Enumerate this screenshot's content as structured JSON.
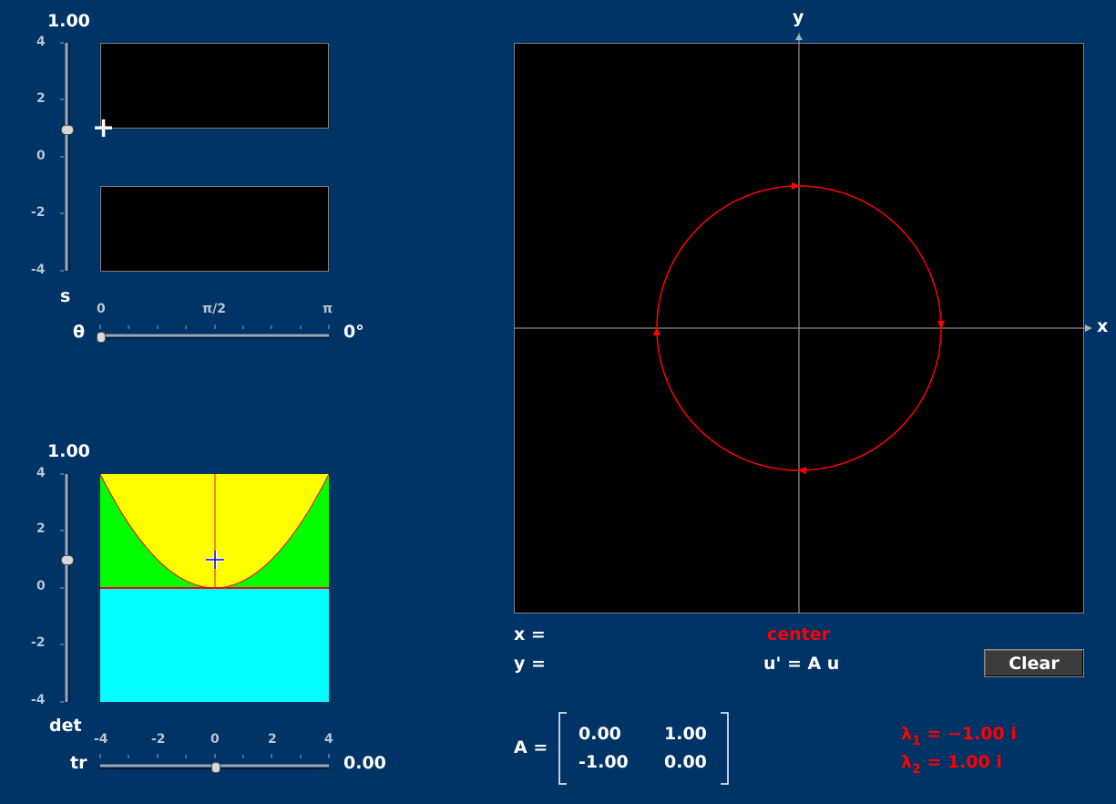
{
  "top_panel": {
    "value_label": "1.00",
    "y_ticks": [
      "4",
      "2",
      "0",
      "-2",
      "-4"
    ],
    "slider_label": "s",
    "theta_label": "θ",
    "theta_ticks": [
      "0",
      "π/2",
      "π"
    ],
    "theta_value": "0°",
    "theta_fraction": 0
  },
  "bottom_panel": {
    "value_label": "1.00",
    "y_ticks": [
      "4",
      "2",
      "0",
      "-2",
      "-4"
    ],
    "slider_label": "det",
    "x_ticks": [
      "-4",
      "-2",
      "0",
      "2",
      "4"
    ],
    "tr_label": "tr",
    "tr_value": "0.00",
    "colors": {
      "stable_region": "#ffff00",
      "spiral_region": "#00ff00",
      "saddle_region": "#00ffff",
      "curve": "#ff0000"
    },
    "trace": 0.0,
    "determinant": 1.0
  },
  "phase_plot": {
    "x_axis_label": "x",
    "y_axis_label": "y",
    "orbit_color": "#ff0000",
    "x_readout_label": "x =",
    "y_readout_label": "y =",
    "classification": "center",
    "equation": "u' = A u",
    "clear_label": "Clear"
  },
  "matrix": {
    "label": "A =",
    "a11": "0.00",
    "a12": "1.00",
    "a21": "-1.00",
    "a22": "0.00"
  },
  "eigenvalues": {
    "l1_symbol": "λ",
    "l1_sub": "1",
    "l1_value": "= −1.00 i",
    "l2_symbol": "λ",
    "l2_sub": "2",
    "l2_value": "= 1.00 i"
  }
}
